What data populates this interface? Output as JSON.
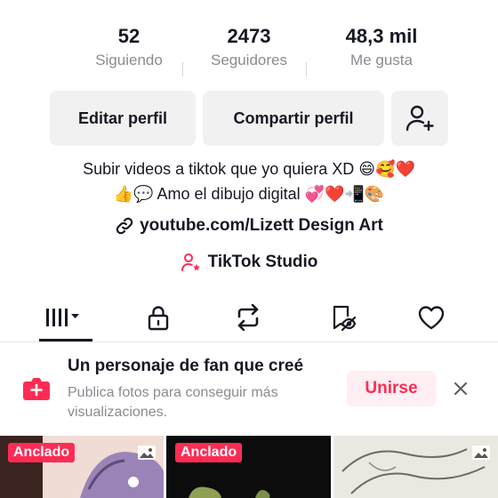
{
  "stats": [
    {
      "value": "52",
      "label": "Siguiendo"
    },
    {
      "value": "2473",
      "label": "Seguidores"
    },
    {
      "value": "48,3 mil",
      "label": "Me gusta"
    }
  ],
  "actions": {
    "edit_label": "Editar perfil",
    "share_label": "Compartir perfil",
    "add_friend_icon": "add-person-icon"
  },
  "bio": {
    "line1": "Subir videos a tiktok que yo quiera XD 😄🥰❤️",
    "line2": "👍💬 Amo el dibujo digital 💞❤️📲🎨"
  },
  "link": {
    "text": "youtube.com/Lizett Design Art",
    "icon": "link-icon"
  },
  "studio": {
    "text": "TikTok Studio",
    "icon": "person-star-icon"
  },
  "tabs": [
    {
      "icon": "videos-grid-icon",
      "selected": true
    },
    {
      "icon": "lock-icon",
      "selected": false
    },
    {
      "icon": "repost-icon",
      "selected": false
    },
    {
      "icon": "hidden-likes-icon",
      "selected": false
    },
    {
      "icon": "heart-icon",
      "selected": false
    }
  ],
  "banner": {
    "title": "Un personaje de fan que creé",
    "subtitle": "Publica fotos para conseguir más visualizaciones.",
    "join_label": "Unirse"
  },
  "grid": {
    "pinned_label": "Anclado"
  },
  "colors": {
    "accent": "#fe2c55",
    "text": "#161823",
    "muted": "#8a8b91",
    "button_bg": "#f1f1f2"
  }
}
